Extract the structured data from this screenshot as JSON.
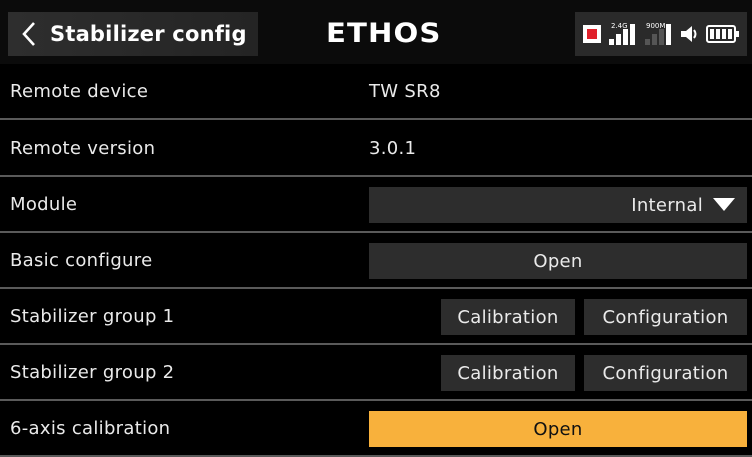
{
  "header": {
    "title": "Stabilizer config",
    "brand_left": "ETH",
    "brand_right": "OS",
    "status_icons": [
      "record-indicator",
      "signal-2.4g-icon",
      "signal-900m-icon",
      "speaker-icon",
      "battery-icon"
    ],
    "signal_24_label": "2.4G",
    "signal_900_label": "900M"
  },
  "rows": {
    "remote_device": {
      "label": "Remote device",
      "value": "TW SR8"
    },
    "remote_version": {
      "label": "Remote version",
      "value": "3.0.1"
    },
    "module": {
      "label": "Module",
      "value": "Internal"
    },
    "basic_configure": {
      "label": "Basic configure",
      "button": "Open"
    },
    "group1": {
      "label": "Stabilizer group 1",
      "calibration": "Calibration",
      "configuration": "Configuration"
    },
    "group2": {
      "label": "Stabilizer group 2",
      "calibration": "Calibration",
      "configuration": "Configuration"
    },
    "six_axis": {
      "label": "6-axis calibration",
      "button": "Open"
    }
  },
  "colors": {
    "accent": "#f8b13c",
    "record": "#e0202a",
    "background": "#000000",
    "button": "#2d2d2d"
  }
}
